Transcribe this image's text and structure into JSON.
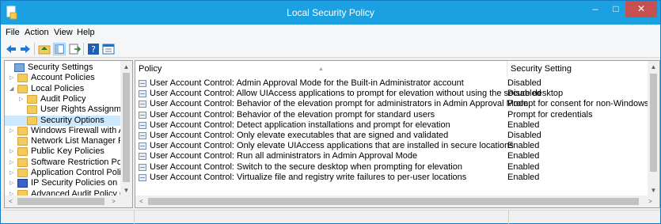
{
  "window": {
    "title": "Local Security Policy",
    "title_color": "#1ba1e2",
    "close_color": "#c75050",
    "minimize_glyph": "–",
    "maximize_glyph": "□",
    "close_glyph": "✕"
  },
  "menu": {
    "items": [
      "File",
      "Action",
      "View",
      "Help"
    ]
  },
  "toolbar": {
    "buttons": [
      "back-icon",
      "forward-icon",
      "up-folder-icon",
      "show-hide-tree-icon",
      "export-list-icon",
      "help-icon",
      "properties-icon"
    ]
  },
  "tree": {
    "items": [
      {
        "label": "Security Settings",
        "level": 0,
        "expander": ""
      },
      {
        "label": "Account Policies",
        "level": 1,
        "expander": "▷"
      },
      {
        "label": "Local Policies",
        "level": 1,
        "expander": "◢"
      },
      {
        "label": "Audit Policy",
        "level": 2,
        "expander": "▷"
      },
      {
        "label": "User Rights Assignme",
        "level": 2,
        "expander": ""
      },
      {
        "label": "Security Options",
        "level": 2,
        "expander": "",
        "selected": true
      },
      {
        "label": "Windows Firewall with Ac",
        "level": 1,
        "expander": "▷"
      },
      {
        "label": "Network List Manager Po",
        "level": 1,
        "expander": ""
      },
      {
        "label": "Public Key Policies",
        "level": 1,
        "expander": "▷"
      },
      {
        "label": "Software Restriction Polic",
        "level": 1,
        "expander": "▷"
      },
      {
        "label": "Application Control Polic",
        "level": 1,
        "expander": "▷"
      },
      {
        "label": "IP Security Policies on Loc",
        "level": 1,
        "expander": "▷"
      },
      {
        "label": "Advanced Audit Policy C",
        "level": 1,
        "expander": "▷"
      }
    ]
  },
  "detail": {
    "columns": {
      "policy": "Policy",
      "setting": "Security Setting"
    },
    "rows": [
      {
        "policy": "User Account Control: Admin Approval Mode for the Built-in Administrator account",
        "setting": "Disabled"
      },
      {
        "policy": "User Account Control: Allow UIAccess applications to prompt for elevation without using the secure desktop",
        "setting": "Disabled"
      },
      {
        "policy": "User Account Control: Behavior of the elevation prompt for administrators in Admin Approval Mode",
        "setting": "Prompt for consent for non-Windows binaries"
      },
      {
        "policy": "User Account Control: Behavior of the elevation prompt for standard users",
        "setting": "Prompt for credentials"
      },
      {
        "policy": "User Account Control: Detect application installations and prompt for elevation",
        "setting": "Enabled"
      },
      {
        "policy": "User Account Control: Only elevate executables that are signed and validated",
        "setting": "Disabled"
      },
      {
        "policy": "User Account Control: Only elevate UIAccess applications that are installed in secure locations",
        "setting": "Enabled"
      },
      {
        "policy": "User Account Control: Run all administrators in Admin Approval Mode",
        "setting": "Enabled"
      },
      {
        "policy": "User Account Control: Switch to the secure desktop when prompting for elevation",
        "setting": "Enabled"
      },
      {
        "policy": "User Account Control: Virtualize file and registry write failures to per-user locations",
        "setting": "Enabled"
      }
    ]
  },
  "scrollbars": {
    "up": "▲",
    "down": "▼",
    "left": "<",
    "right": ">"
  }
}
